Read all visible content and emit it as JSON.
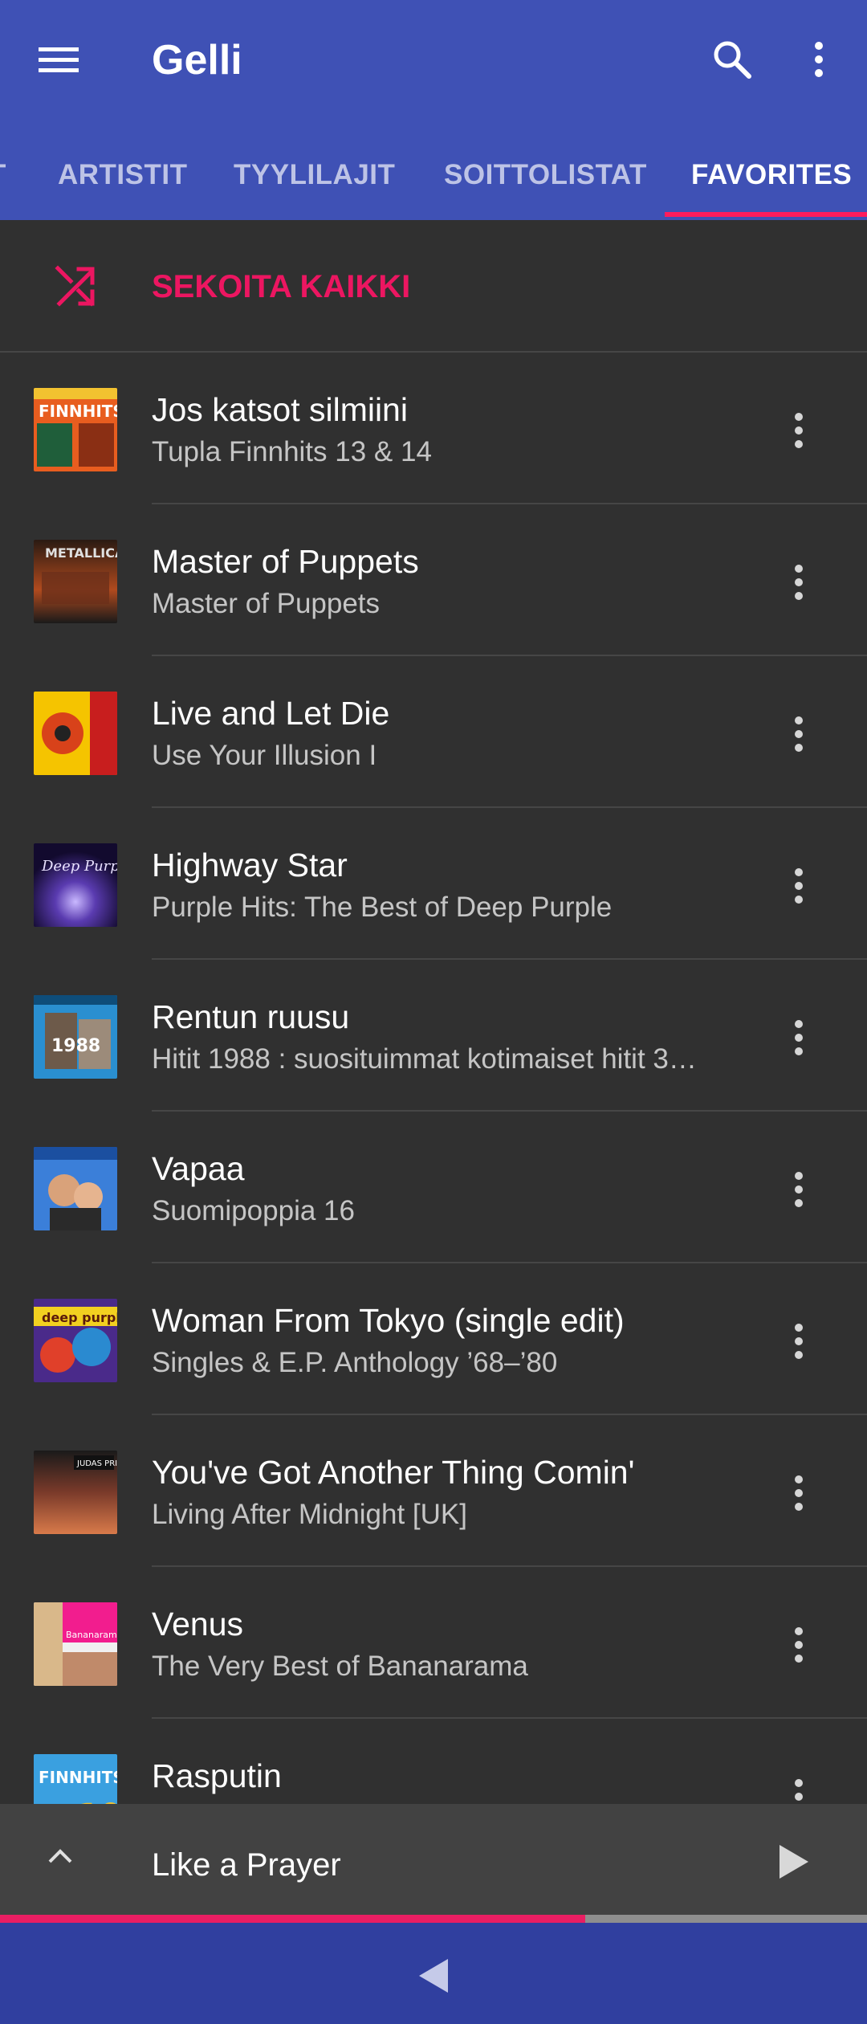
{
  "app_bar": {
    "title": "Gelli",
    "menu_icon": "hamburger-menu-icon",
    "search_icon": "search-icon",
    "overflow_icon": "more-vertical-icon",
    "background_color": "#3f51b5"
  },
  "tabs": [
    {
      "label": "T",
      "active": false
    },
    {
      "label": "ARTISTIT",
      "active": false
    },
    {
      "label": "TYYLILAJIT",
      "active": false
    },
    {
      "label": "SOITTOLISTAT",
      "active": false
    },
    {
      "label": "FAVORITES",
      "active": true
    }
  ],
  "shuffle": {
    "label": "SEKOITA KAIKKI",
    "icon": "shuffle-icon",
    "color": "#ec1661"
  },
  "tracks": [
    {
      "title": "Jos katsot silmiini",
      "album": "Tupla Finnhits 13 & 14"
    },
    {
      "title": "Master of Puppets",
      "album": "Master of Puppets"
    },
    {
      "title": "Live and Let Die",
      "album": "Use Your Illusion I"
    },
    {
      "title": "Highway Star",
      "album": "Purple Hits: The Best of Deep Purple"
    },
    {
      "title": "Rentun ruusu",
      "album": "Hitit 1988 : suosituimmat kotimaiset hitit 3…"
    },
    {
      "title": "Vapaa",
      "album": "Suomipoppia 16"
    },
    {
      "title": "Woman From Tokyo (single edit)",
      "album": "Singles & E.P. Anthology ’68–’80"
    },
    {
      "title": "You've Got Another Thing Comin'",
      "album": "Living After Midnight [UK]"
    },
    {
      "title": "Venus",
      "album": "The Very Best of Bananarama"
    },
    {
      "title": "Rasputin",
      "album": ""
    }
  ],
  "mini_player": {
    "title": "Like a Prayer",
    "expand_icon": "chevron-up-icon",
    "play_icon": "play-icon",
    "progress": 0.675,
    "progress_color": "#e91e63"
  },
  "system_nav": {
    "back_icon": "back-triangle-icon"
  }
}
